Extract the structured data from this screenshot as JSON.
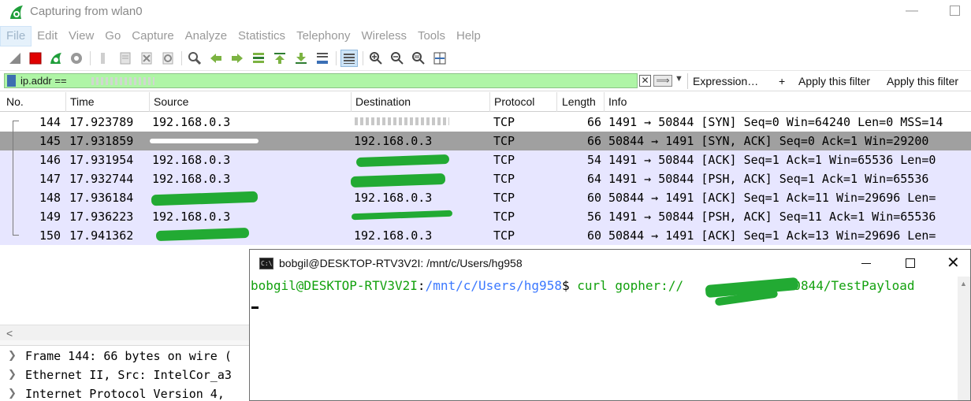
{
  "wireshark": {
    "title": "Capturing from wlan0",
    "menu": [
      "File",
      "Edit",
      "View",
      "Go",
      "Capture",
      "Analyze",
      "Statistics",
      "Telephony",
      "Wireless",
      "Tools",
      "Help"
    ],
    "filter": {
      "value": "ip.addr == ",
      "expression_label": "Expression…",
      "plus": "+",
      "apply_label_1": "Apply this filter",
      "apply_label_2": "Apply this filter"
    },
    "columns": [
      "No.",
      "Time",
      "Source",
      "Destination",
      "Protocol",
      "Length",
      "Info"
    ],
    "packets": [
      {
        "no": "144",
        "time": "17.923789",
        "source": "192.168.0.3",
        "destination": "",
        "protocol": "TCP",
        "length": "66",
        "info": "1491 → 50844 [SYN] Seq=0 Win=64240 Len=0 MSS=14"
      },
      {
        "no": "145",
        "time": "17.931859",
        "source": "",
        "destination": "192.168.0.3",
        "protocol": "TCP",
        "length": "66",
        "info": "50844 → 1491 [SYN, ACK] Seq=0 Ack=1 Win=29200"
      },
      {
        "no": "146",
        "time": "17.931954",
        "source": "192.168.0.3",
        "destination": "",
        "protocol": "TCP",
        "length": "54",
        "info": "1491 → 50844 [ACK] Seq=1 Ack=1 Win=65536 Len=0"
      },
      {
        "no": "147",
        "time": "17.932744",
        "source": "192.168.0.3",
        "destination": "",
        "protocol": "TCP",
        "length": "64",
        "info": "1491 → 50844 [PSH, ACK] Seq=1 Ack=1 Win=65536"
      },
      {
        "no": "148",
        "time": "17.936184",
        "source": "",
        "destination": "192.168.0.3",
        "protocol": "TCP",
        "length": "60",
        "info": "50844 → 1491 [ACK] Seq=1 Ack=11 Win=29696 Len="
      },
      {
        "no": "149",
        "time": "17.936223",
        "source": "192.168.0.3",
        "destination": "",
        "protocol": "TCP",
        "length": "56",
        "info": "1491 → 50844 [PSH, ACK] Seq=11 Ack=1 Win=65536"
      },
      {
        "no": "150",
        "time": "17.941362",
        "source": "",
        "destination": "192.168.0.3",
        "protocol": "TCP",
        "length": "60",
        "info": "50844 → 1491 [ACK] Seq=1 Ack=13 Win=29696 Len="
      }
    ],
    "details": [
      "Frame 144: 66 bytes on wire (",
      "Ethernet II, Src: IntelCor_a3",
      "Internet Protocol Version 4,"
    ],
    "colors": {
      "selected_row": "#a0a0a0",
      "tcp_row": "#e7e6ff",
      "filter_valid": "#aff5a6"
    }
  },
  "terminal": {
    "title": "bobgil@DESKTOP-RTV3V2I: /mnt/c/Users/hg958",
    "prompt_user": "bobgil@DESKTOP-RTV3V2I",
    "prompt_sep": ":",
    "prompt_path": "/mnt/c/Users/hg958",
    "prompt_end": "$ ",
    "command_prefix": "curl gopher://",
    "command_suffix": ":50844/TestPayload",
    "colors": {
      "user": "#13a10e",
      "path": "#3b78ff"
    }
  }
}
